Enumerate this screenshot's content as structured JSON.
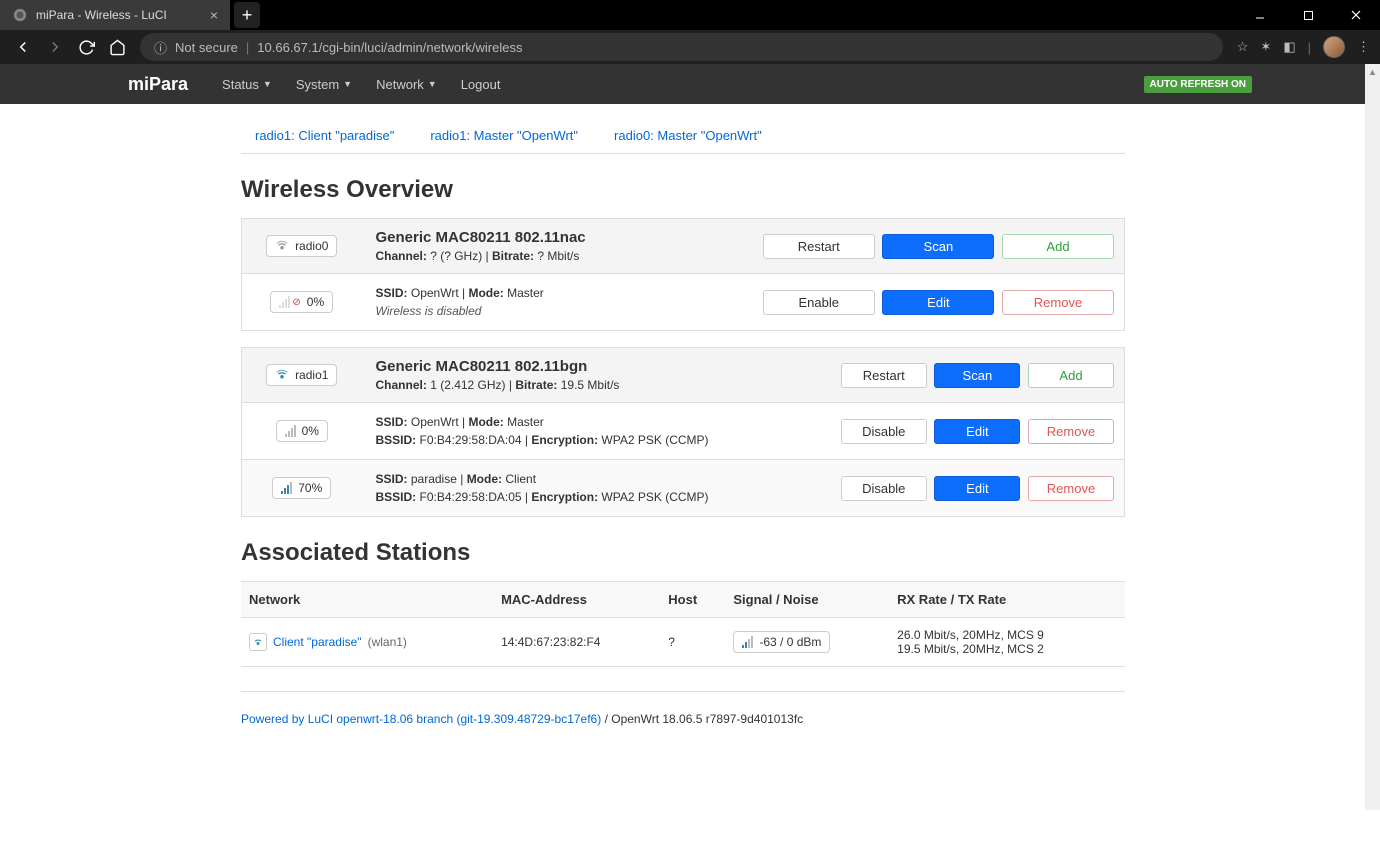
{
  "browser": {
    "tab_title": "miPara - Wireless - LuCI",
    "not_secure": "Not secure",
    "url": "10.66.67.1/cgi-bin/luci/admin/network/wireless"
  },
  "header": {
    "brand": "miPara",
    "menu": {
      "status": "Status",
      "system": "System",
      "network": "Network",
      "logout": "Logout"
    },
    "auto_refresh": "AUTO REFRESH ON"
  },
  "tabs": {
    "t0": "radio1: Client \"paradise\"",
    "t1": "radio1: Master \"OpenWrt\"",
    "t2": "radio0: Master \"OpenWrt\""
  },
  "h_wireless": "Wireless Overview",
  "labels": {
    "channel": "Channel:",
    "bitrate": "Bitrate:",
    "ssid": "SSID:",
    "mode": "Mode:",
    "bssid": "BSSID:",
    "encryption": "Encryption:"
  },
  "btns": {
    "restart": "Restart",
    "scan": "Scan",
    "add": "Add",
    "enable": "Enable",
    "disable": "Disable",
    "edit": "Edit",
    "remove": "Remove"
  },
  "radio0": {
    "badge": "radio0",
    "title": "Generic MAC80211 802.11nac",
    "channel": "? (? GHz)",
    "bitrate": "? Mbit/s",
    "net0": {
      "pct": "0%",
      "ssid": "OpenWrt",
      "mode": "Master",
      "disabled": "Wireless is disabled"
    }
  },
  "radio1": {
    "badge": "radio1",
    "title": "Generic MAC80211 802.11bgn",
    "channel": "1 (2.412 GHz)",
    "bitrate": "19.5 Mbit/s",
    "net0": {
      "pct": "0%",
      "ssid": "OpenWrt",
      "mode": "Master",
      "bssid": "F0:B4:29:58:DA:04",
      "enc": "WPA2 PSK (CCMP)"
    },
    "net1": {
      "pct": "70%",
      "ssid": "paradise",
      "mode": "Client",
      "bssid": "F0:B4:29:58:DA:05",
      "enc": "WPA2 PSK (CCMP)"
    }
  },
  "h_assoc": "Associated Stations",
  "assoc_headers": {
    "network": "Network",
    "mac": "MAC-Address",
    "host": "Host",
    "signal": "Signal / Noise",
    "rate": "RX Rate / TX Rate"
  },
  "assoc0": {
    "net_label": "Client \"paradise\"",
    "net_if": "(wlan1)",
    "mac": "14:4D:67:23:82:F4",
    "host": "?",
    "signal": "-63 / 0 dBm",
    "rx": "26.0 Mbit/s, 20MHz, MCS 9",
    "tx": "19.5 Mbit/s, 20MHz, MCS 2"
  },
  "footer": {
    "link": "Powered by LuCI openwrt-18.06 branch (git-19.309.48729-bc17ef6)",
    "rest": " / OpenWrt 18.06.5 r7897-9d401013fc"
  }
}
